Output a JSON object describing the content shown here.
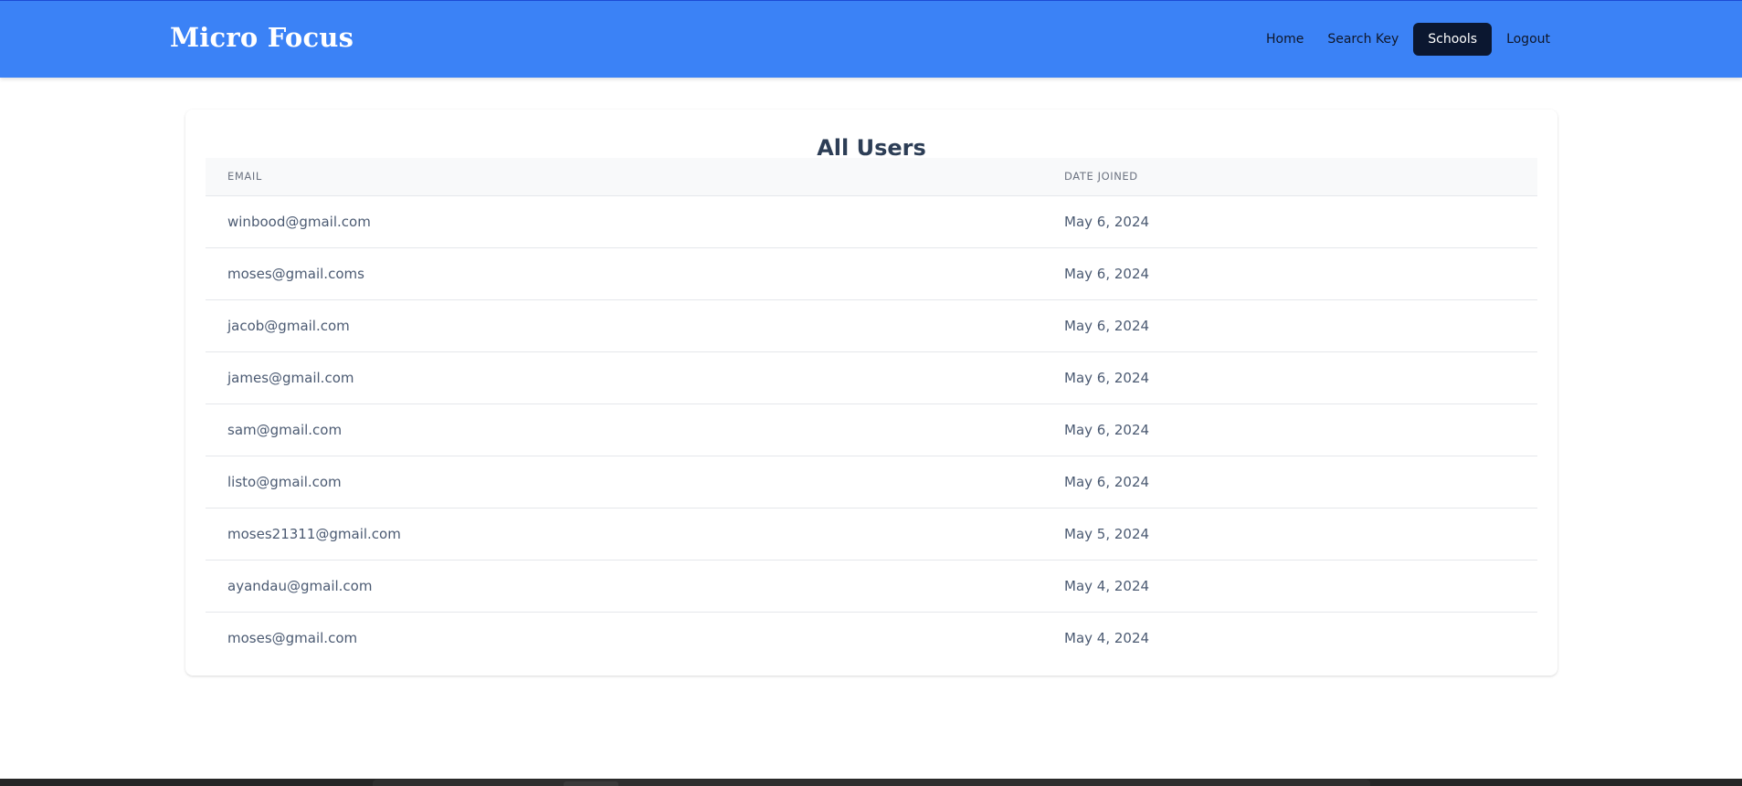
{
  "navbar": {
    "brand": "Micro Focus",
    "links": [
      {
        "label": "Home",
        "active": false
      },
      {
        "label": "Search Key",
        "active": false
      },
      {
        "label": "Schools",
        "active": true
      },
      {
        "label": "Logout",
        "active": false
      }
    ]
  },
  "users_table": {
    "title": "All Users",
    "columns": [
      "EMAIL",
      "DATE JOINED"
    ],
    "rows": [
      {
        "email": "winbood@gmail.com",
        "date_joined": "May 6, 2024"
      },
      {
        "email": "moses@gmail.coms",
        "date_joined": "May 6, 2024"
      },
      {
        "email": "jacob@gmail.com",
        "date_joined": "May 6, 2024"
      },
      {
        "email": "james@gmail.com",
        "date_joined": "May 6, 2024"
      },
      {
        "email": "sam@gmail.com",
        "date_joined": "May 6, 2024"
      },
      {
        "email": "listo@gmail.com",
        "date_joined": "May 6, 2024"
      },
      {
        "email": "moses21311@gmail.com",
        "date_joined": "May 5, 2024"
      },
      {
        "email": "ayandau@gmail.com",
        "date_joined": "May 4, 2024"
      },
      {
        "email": "moses@gmail.com",
        "date_joined": "May 4, 2024"
      }
    ]
  },
  "colors": {
    "navbar_bg": "#3b82f6",
    "active_link_bg": "#0b1730",
    "title_text": "#2d3e56",
    "cell_text": "#4b5a72"
  }
}
